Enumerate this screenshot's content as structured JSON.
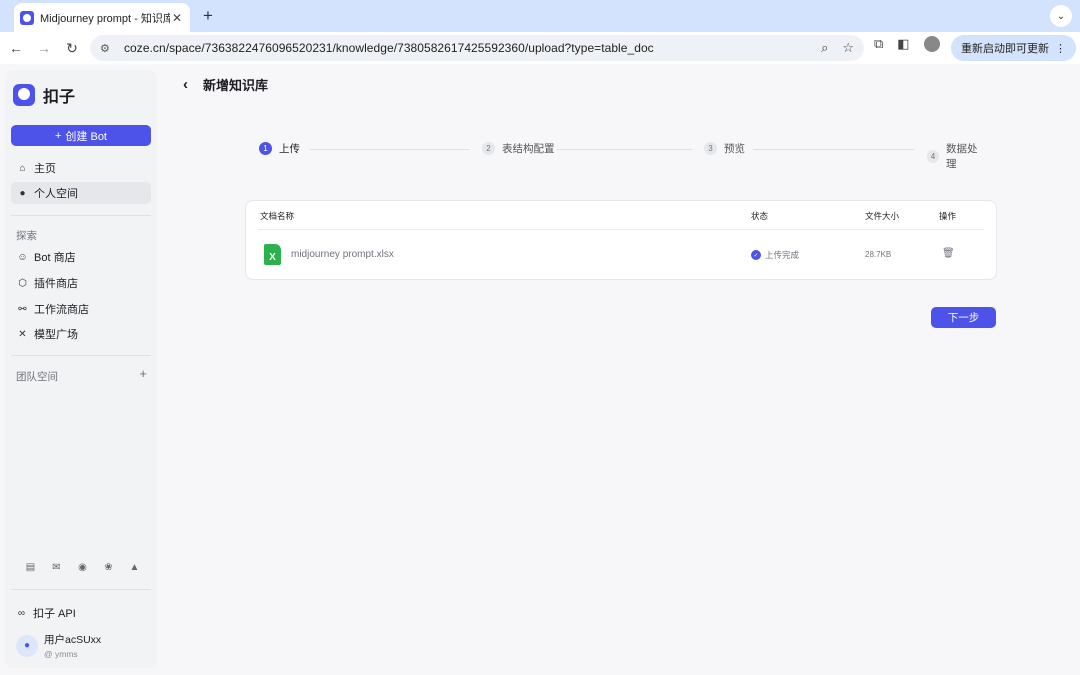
{
  "browser": {
    "tab_title": "Midjourney prompt - 知识库 -",
    "tab_close": "✕",
    "new_tab": "+",
    "tab_menu": "⌄",
    "url": "coze.cn/space/7363822476096520231/knowledge/7380582617425592360/upload?type=table_doc",
    "update_label": "重新启动即可更新",
    "update_menu": "⋮"
  },
  "sidebar": {
    "brand": "扣子",
    "create_label": "创建 Bot",
    "create_icon": "+",
    "nav": [
      {
        "label": "主页",
        "icon": "home-icon",
        "glyph": "⌂"
      },
      {
        "label": "个人空间",
        "icon": "user-icon",
        "glyph": "●"
      }
    ],
    "explore_label": "探索",
    "explore": [
      {
        "label": "Bot 商店",
        "icon": "bot-icon",
        "glyph": "☺"
      },
      {
        "label": "插件商店",
        "icon": "cube-icon",
        "glyph": "⬡"
      },
      {
        "label": "工作流商店",
        "icon": "workflow-icon",
        "glyph": "⚯"
      },
      {
        "label": "模型广场",
        "icon": "model-icon",
        "glyph": "✕"
      }
    ],
    "team_label": "团队空间",
    "team_add": "+",
    "api_label": "扣子 API",
    "user_name": "用户acSUxx",
    "user_handle": "@ ymms"
  },
  "main": {
    "back_glyph": "‹",
    "title": "新增知识库",
    "steps": [
      {
        "num": "1",
        "label": "上传"
      },
      {
        "num": "2",
        "label": "表结构配置"
      },
      {
        "num": "3",
        "label": "预览"
      },
      {
        "num": "4",
        "label": "数据处理"
      }
    ],
    "active_step": 1,
    "table": {
      "headers": [
        "文档名称",
        "状态",
        "文件大小",
        "操作"
      ],
      "rows": [
        {
          "file_icon": "X",
          "name": "midjourney prompt.xlsx",
          "status": "上传完成",
          "size": "28.7KB"
        }
      ]
    },
    "next_label": "下一步"
  },
  "colors": {
    "accent": "#4d53e8",
    "excel_green": "#2bb24c",
    "browser_tabbar": "#d3e3fd"
  }
}
